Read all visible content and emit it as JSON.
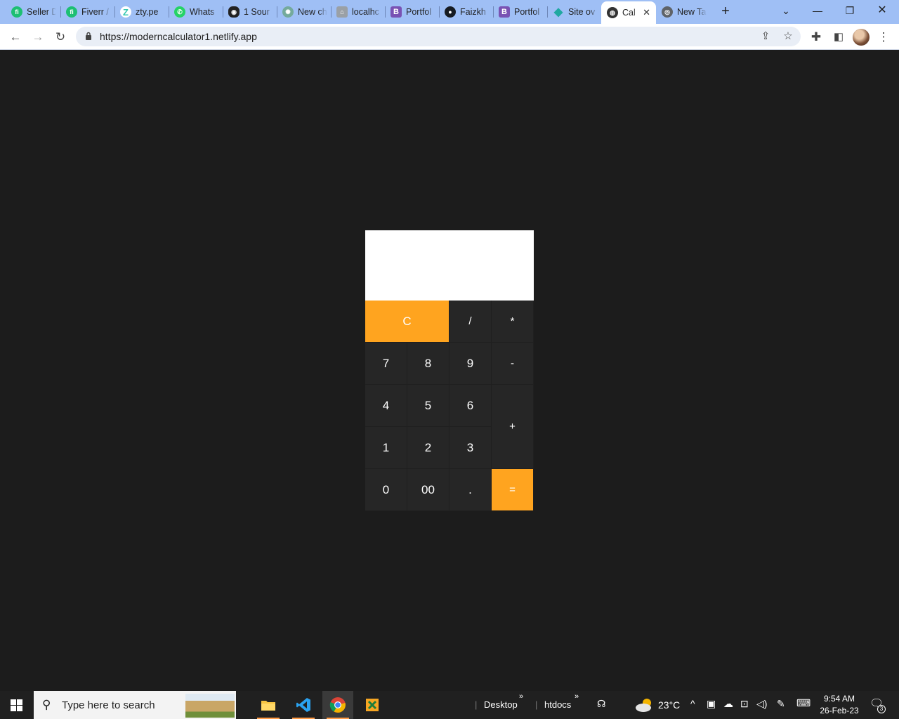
{
  "browser": {
    "tabs": [
      {
        "label": "Seller D",
        "icon": "fiverr-icon",
        "color": "#1dbf73"
      },
      {
        "label": "Fiverr /",
        "icon": "fiverr-icon",
        "color": "#1dbf73"
      },
      {
        "label": "zty.pe",
        "icon": "ztype-icon",
        "color": "#33c7b0"
      },
      {
        "label": "Whats",
        "icon": "whatsapp-icon",
        "color": "#25d366"
      },
      {
        "label": "1 Sour",
        "icon": "eye-icon",
        "color": "#222222"
      },
      {
        "label": "New ch",
        "icon": "openai-icon",
        "color": "#74aa9c"
      },
      {
        "label": "localhc",
        "icon": "localhost-icon",
        "color": "#9aa0a6"
      },
      {
        "label": "Portfol",
        "icon": "bootstrap-icon",
        "color": "#7952b3"
      },
      {
        "label": "Faizkh",
        "icon": "github-icon",
        "color": "#161b22"
      },
      {
        "label": "Portfol",
        "icon": "bootstrap-icon",
        "color": "#7952b3"
      },
      {
        "label": "Site ov",
        "icon": "netlify-icon",
        "color": "#20a8a1"
      },
      {
        "label": "Cal",
        "icon": "globe-icon",
        "color": "#333333",
        "active": true
      },
      {
        "label": "New Ta",
        "icon": "chrome-icon",
        "color": "#5f6368"
      }
    ],
    "url": "https://moderncalculator1.netlify.app"
  },
  "calculator": {
    "display_value": "",
    "keys": {
      "clear": "C",
      "divide": "/",
      "multiply": "*",
      "seven": "7",
      "eight": "8",
      "nine": "9",
      "minus": "-",
      "four": "4",
      "five": "5",
      "six": "6",
      "plus": "+",
      "one": "1",
      "two": "2",
      "three": "3",
      "zero": "0",
      "double_zero": "00",
      "dot": ".",
      "equals": "="
    },
    "accent_color": "#ffa41f",
    "key_color": "#262626"
  },
  "taskbar": {
    "search_placeholder": "Type here to search",
    "folder1": "Desktop",
    "folder2": "htdocs",
    "weather": "23°C",
    "time": "9:54 AM",
    "date": "26-Feb-23",
    "notification_count": "3"
  }
}
